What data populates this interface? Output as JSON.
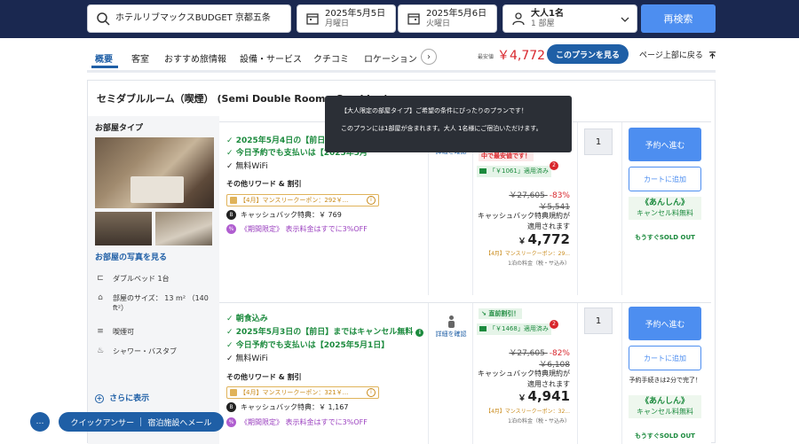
{
  "header": {
    "hotel_name": "ホテルリブマックスBUDGET 京都五条",
    "checkin": {
      "date": "2025年5月5日",
      "day": "月曜日"
    },
    "checkout": {
      "date": "2025年5月6日",
      "day": "火曜日"
    },
    "guests": {
      "adults": "大人1名",
      "rooms": "1 部屋"
    },
    "search_label": "再検索"
  },
  "nav": {
    "tabs": [
      {
        "label": "概要"
      },
      {
        "label": "客室"
      },
      {
        "label": "おすすめ旅情報"
      },
      {
        "label": "設備・サービス"
      },
      {
        "label": "クチコミ"
      },
      {
        "label": "ロケーション"
      }
    ],
    "next_arrow": "›",
    "lowest_label": "最安値",
    "lowest_price": "￥4,772",
    "plan_button": "このプランを見る",
    "back_to_top": "ページ上部に戻る"
  },
  "room": {
    "title": "セミダブルルーム（喫煙） (Semi Double Room - Smoking)",
    "type_label": "お部屋タイプ",
    "photo_link": "お部屋の写真を見る",
    "amenities": [
      {
        "icon": "bed-icon",
        "glyph": "⊏",
        "text": "ダブルベッド 1台"
      },
      {
        "icon": "room-size-icon",
        "glyph": "⌂",
        "text": "部屋のサイズ： 13 m² （140 ft²）"
      },
      {
        "icon": "smoking-icon",
        "glyph": "≡",
        "text": "喫煙可"
      },
      {
        "icon": "shower-icon",
        "glyph": "♨",
        "text": "シャワー・バスタブ"
      }
    ],
    "more_link": "さらに表示"
  },
  "tooltip": {
    "line1": "【大人限定の部屋タイプ】ご希望の条件にぴったりのプランです！",
    "line2": "このプランには1部屋が含まれます。大人 1名様にご宿泊いただけます。"
  },
  "plans": [
    {
      "features": [
        {
          "style": "green",
          "text": "2025年5月4日の【前日】までは"
        },
        {
          "style": "green",
          "text": "今日予約でも支払いは【2025年5月"
        },
        {
          "style": "black",
          "text": "無料WiFi"
        }
      ],
      "reward_head": "その他リワード & 割引",
      "coupon": "【4月】マンスリークーポン：292￥...",
      "cashback": "キャッシュバック特典：￥ 769",
      "promo": "《期間限定》 表示料金はすでに3%OFF",
      "detail": "詳細を確認",
      "badge": "中で最安値です！",
      "coupon_applied": "「￥1061」適用済み",
      "coupon_count": "2",
      "orig_price": "￥27,605",
      "discount": "-83%",
      "mid_price": "￥5,541",
      "note": "キャッシュバック特典規約が適用されます",
      "final_price": "4,772",
      "cpn_note": "【4月】マンスリークーポン：29...",
      "tax_note": "1泊の料金（税・サ込み）",
      "qty": "1",
      "reserve": "予約へ進む",
      "cart": "カートに追加",
      "ansin_title": "《あんしん》",
      "ansin_sub": "キャンセル料無料",
      "soldout": "もうすぐSOLD OUT"
    },
    {
      "features": [
        {
          "style": "green",
          "text": "朝食込み"
        },
        {
          "style": "green",
          "text": "2025年5月3日の【前日】まではキャンセル無料"
        },
        {
          "style": "green",
          "text": "今日予約でも支払いは【2025年5月1日】"
        },
        {
          "style": "black",
          "text": "無料WiFi"
        }
      ],
      "reward_head": "その他リワード & 割引",
      "coupon": "【4月】マンスリークーポン：321￥...",
      "cashback": "キャッシュバック特典：￥ 1,167",
      "promo": "《期間限定》 表示料金はすでに3%OFF",
      "detail": "詳細を確認",
      "badge": "直前割引！",
      "coupon_applied": "「￥1468」適用済み",
      "coupon_count": "2",
      "orig_price": "￥27,605",
      "discount": "-82%",
      "mid_price": "￥6,108",
      "note": "キャッシュバック特典規約が適用されます",
      "final_price": "4,941",
      "cpn_note": "【4月】マンスリークーポン：32...",
      "tax_note": "1泊の料金（税・サ込み）",
      "qty": "1",
      "reserve": "予約へ進む",
      "cart": "カートに追加",
      "proc_note": "予約手続きは2分で完了！",
      "ansin_title": "《あんしん》",
      "ansin_sub": "キャンセル料無料",
      "soldout": "もうすぐSOLD OUT"
    }
  ],
  "chat": {
    "quick_answer": "クイックアンサー",
    "message": "宿泊施設へメール"
  },
  "colors": {
    "header_bg": "#1a2850",
    "accent_blue": "#4d8ef0",
    "link_blue": "#1f5fa6",
    "price_red": "#d8262c",
    "green": "#1b8a3d"
  }
}
